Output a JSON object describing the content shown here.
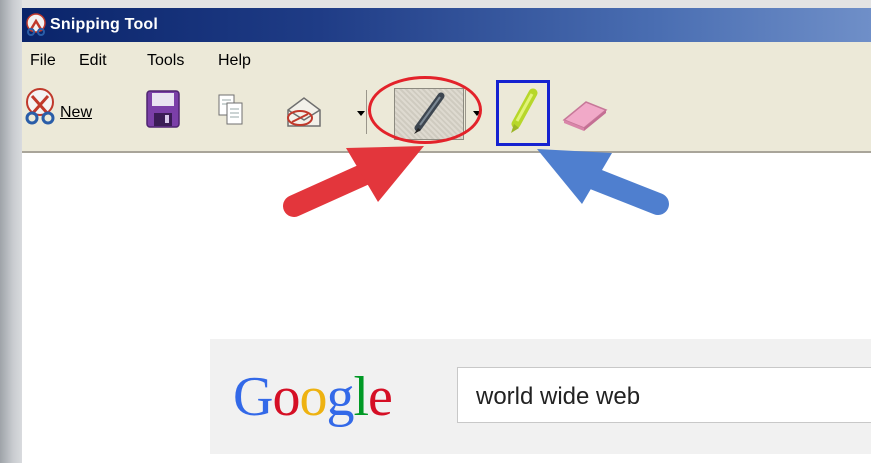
{
  "window": {
    "title": "Snipping Tool"
  },
  "menu": {
    "items": [
      "File",
      "Edit",
      "Tools",
      "Help"
    ]
  },
  "toolbar": {
    "new_label": "New",
    "icons": [
      "scissors-icon",
      "save-icon",
      "copy-icon",
      "send-email-icon",
      "pen-icon",
      "highlighter-icon",
      "eraser-icon"
    ]
  },
  "annotations": {
    "red_circle": "pen-icon",
    "blue_box": "highlighter-icon",
    "colors": {
      "red": "#e3222a",
      "blue": "#1522d0"
    }
  },
  "google": {
    "logo_letters": [
      {
        "ch": "G",
        "color": "#3369e8"
      },
      {
        "ch": "o",
        "color": "#d50f25"
      },
      {
        "ch": "o",
        "color": "#eeb211"
      },
      {
        "ch": "g",
        "color": "#3369e8"
      },
      {
        "ch": "l",
        "color": "#009925"
      },
      {
        "ch": "e",
        "color": "#d50f25"
      }
    ],
    "search_value": "world wide web"
  }
}
